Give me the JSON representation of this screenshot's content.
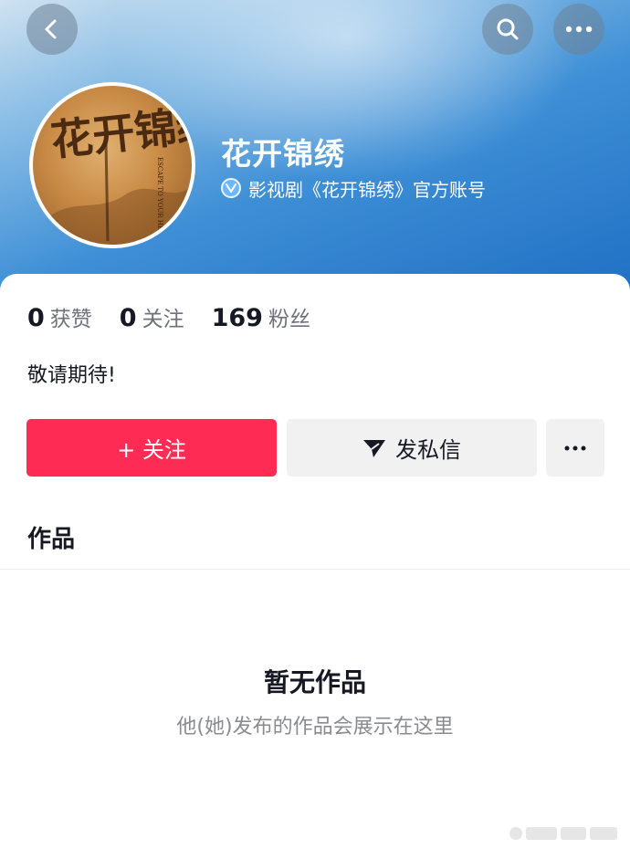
{
  "profile": {
    "name": "花开锦绣",
    "verification": "影视剧《花开锦绣》官方账号",
    "bio": "敬请期待!"
  },
  "avatar_art": {
    "title": "花开锦绣",
    "subtitle": "ESCAPE TO YOUR HEART"
  },
  "stats": [
    {
      "value": "0",
      "label": "获赞"
    },
    {
      "value": "0",
      "label": "关注"
    },
    {
      "value": "169",
      "label": "粉丝"
    }
  ],
  "actions": {
    "follow_label": "+ 关注",
    "message_label": "发私信"
  },
  "works": {
    "title": "作品",
    "empty_title": "暂无作品",
    "empty_subtitle": "他(她)发布的作品会展示在这里"
  },
  "icons": {
    "back": "chevron-left-icon",
    "search": "search-icon",
    "more": "ellipsis-icon",
    "verified": "verified-badge-icon",
    "message": "paper-plane-icon"
  },
  "colors": {
    "accent": "#fe2c55",
    "secondary_button": "#f1f1f2",
    "header_gradient": "#3e8fd6"
  }
}
